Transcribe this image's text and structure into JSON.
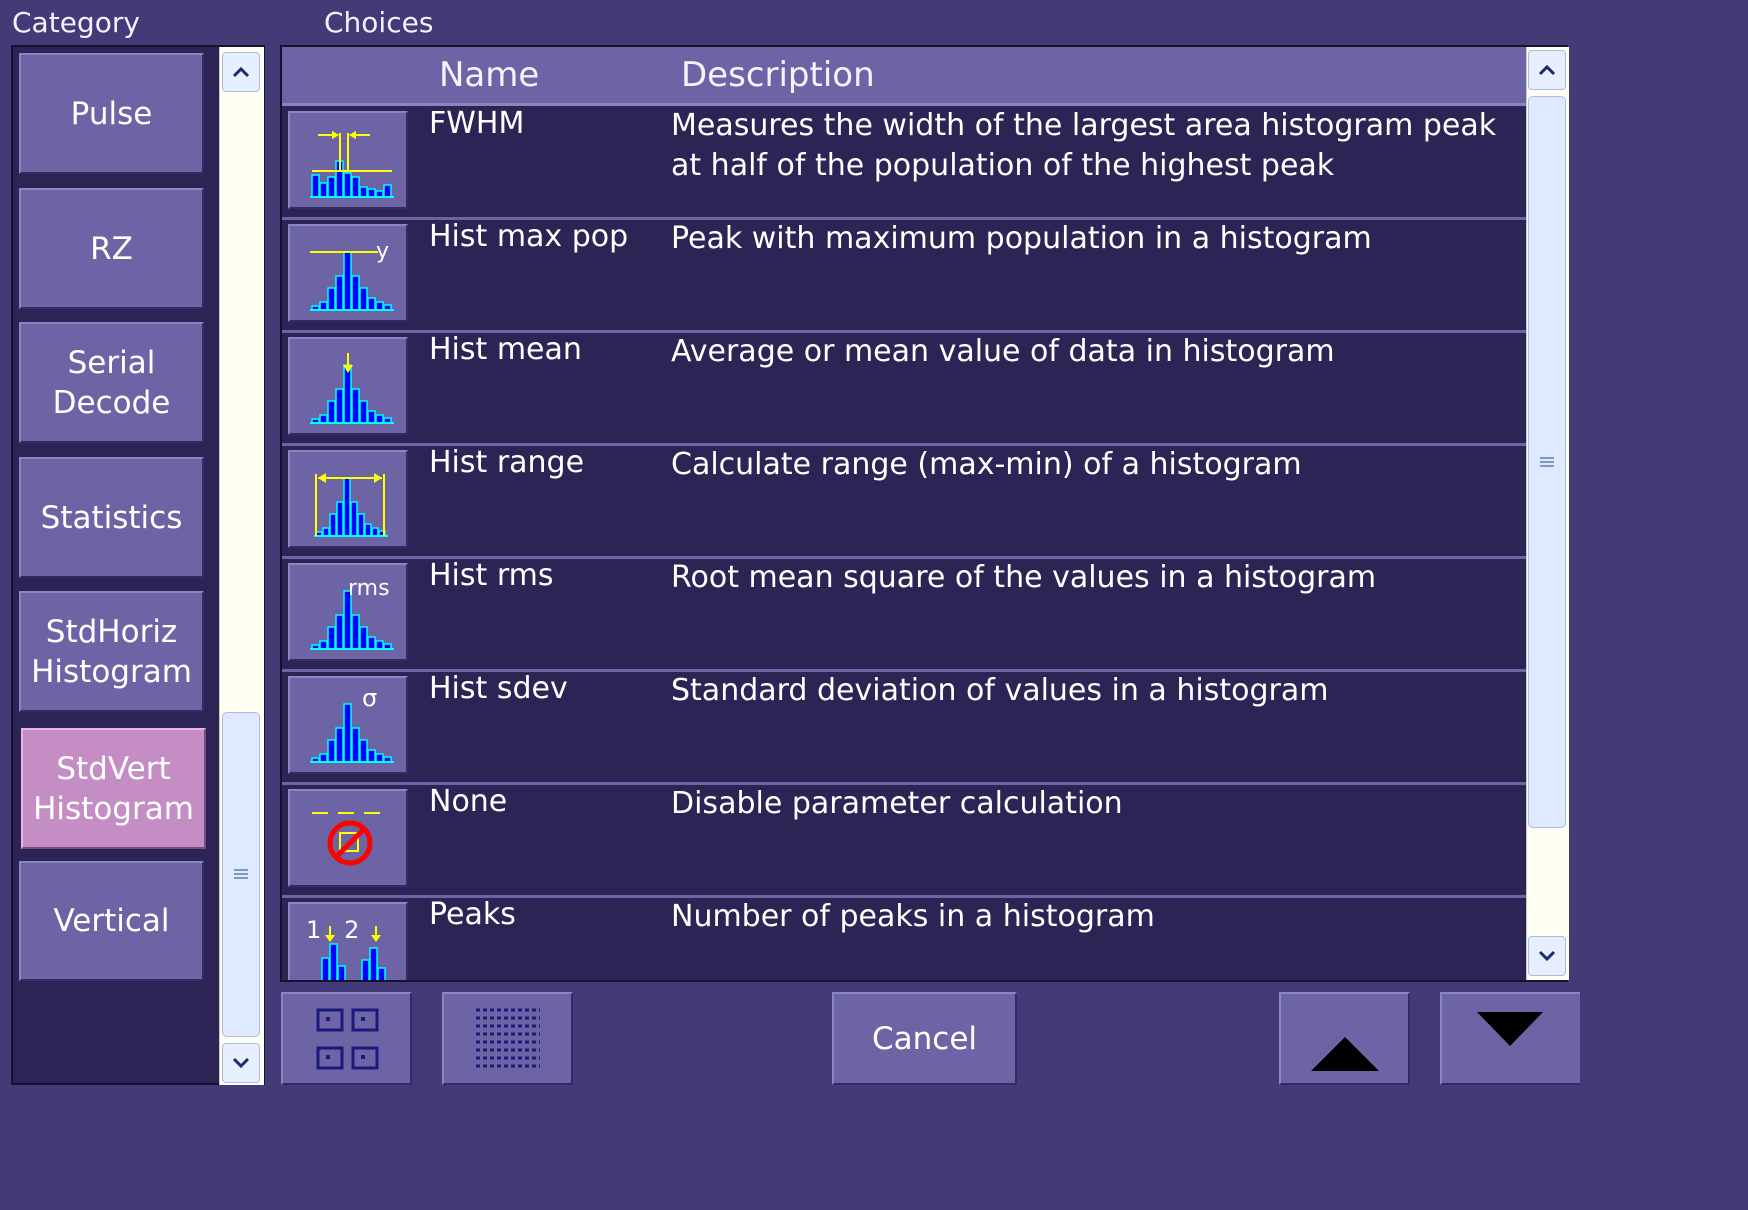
{
  "headers": {
    "category": "Category",
    "choices": "Choices"
  },
  "categories": [
    {
      "label": "Pulse",
      "selected": false
    },
    {
      "label": "RZ",
      "selected": false
    },
    {
      "label": "Serial\nDecode",
      "selected": false
    },
    {
      "label": "Statistics",
      "selected": false
    },
    {
      "label": "StdHoriz\nHistogram",
      "selected": false
    },
    {
      "label": "StdVert\nHistogram",
      "selected": true
    },
    {
      "label": "Vertical",
      "selected": false
    }
  ],
  "table": {
    "columns": {
      "name": "Name",
      "description": "Description"
    },
    "rows": [
      {
        "name": "FWHM",
        "description": "Measures the width of the largest area histogram peak at half of the population of the highest peak",
        "icon": "fwhm-histogram-icon",
        "icon_text": ""
      },
      {
        "name": "Hist max pop",
        "description": "Peak with maximum population in a histogram",
        "icon": "max-pop-histogram-icon",
        "icon_text": "y"
      },
      {
        "name": "Hist mean",
        "description": "Average or mean value of data in histogram",
        "icon": "mean-histogram-icon",
        "icon_text": ""
      },
      {
        "name": "Hist range",
        "description": "Calculate range (max-min) of a histogram",
        "icon": "range-histogram-icon",
        "icon_text": ""
      },
      {
        "name": "Hist rms",
        "description": "Root mean square of the values in a histogram",
        "icon": "rms-histogram-icon",
        "icon_text": "rms"
      },
      {
        "name": "Hist sdev",
        "description": "Standard deviation of values in a histogram",
        "icon": "sdev-histogram-icon",
        "icon_text": "σ"
      },
      {
        "name": "None",
        "description": "Disable parameter calculation",
        "icon": "disabled-icon",
        "icon_text": ""
      },
      {
        "name": "Peaks",
        "description": "Number of peaks in a histogram",
        "icon": "peaks-histogram-icon",
        "icon_text": "1   2"
      }
    ]
  },
  "toolbar": {
    "grid_view": "grid-view-icon",
    "list_view": "list-view-icon",
    "cancel_label": "Cancel",
    "up": "triangle-up-icon",
    "down": "triangle-down-icon"
  },
  "colors": {
    "background": "#433a78",
    "panel": "#2b2455",
    "button": "#6c64a5",
    "selected": "#c48dc4",
    "bars": "#0000ff",
    "bar_outline": "#00ffff",
    "marker": "#ffff00",
    "no_symbol": "#ff0000"
  }
}
